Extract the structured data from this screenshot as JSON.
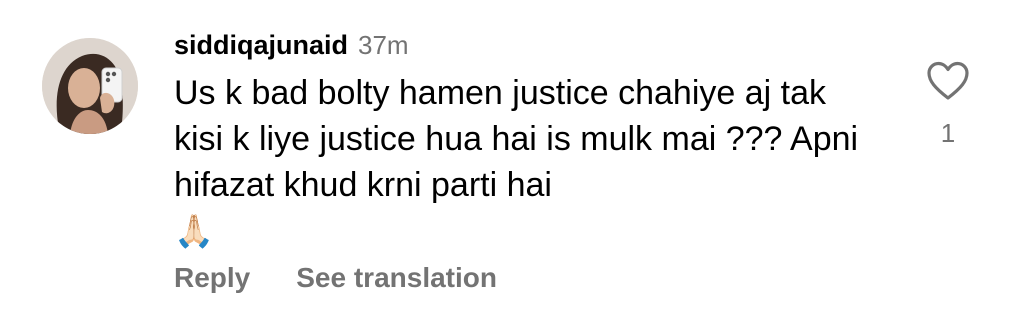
{
  "comment": {
    "username": "siddiqajunaid",
    "timestamp": "37m",
    "text": "Us k bad bolty hamen justice chahiye aj tak kisi k liye justice hua hai is mulk mai ??? Apni hifazat khud krni parti hai",
    "emoji": "🙏🏻",
    "avatar_icon": "profile-photo",
    "actions": {
      "reply": "Reply",
      "see_translation": "See translation"
    },
    "likes": {
      "icon": "heart-outline-icon",
      "count": "1"
    }
  }
}
